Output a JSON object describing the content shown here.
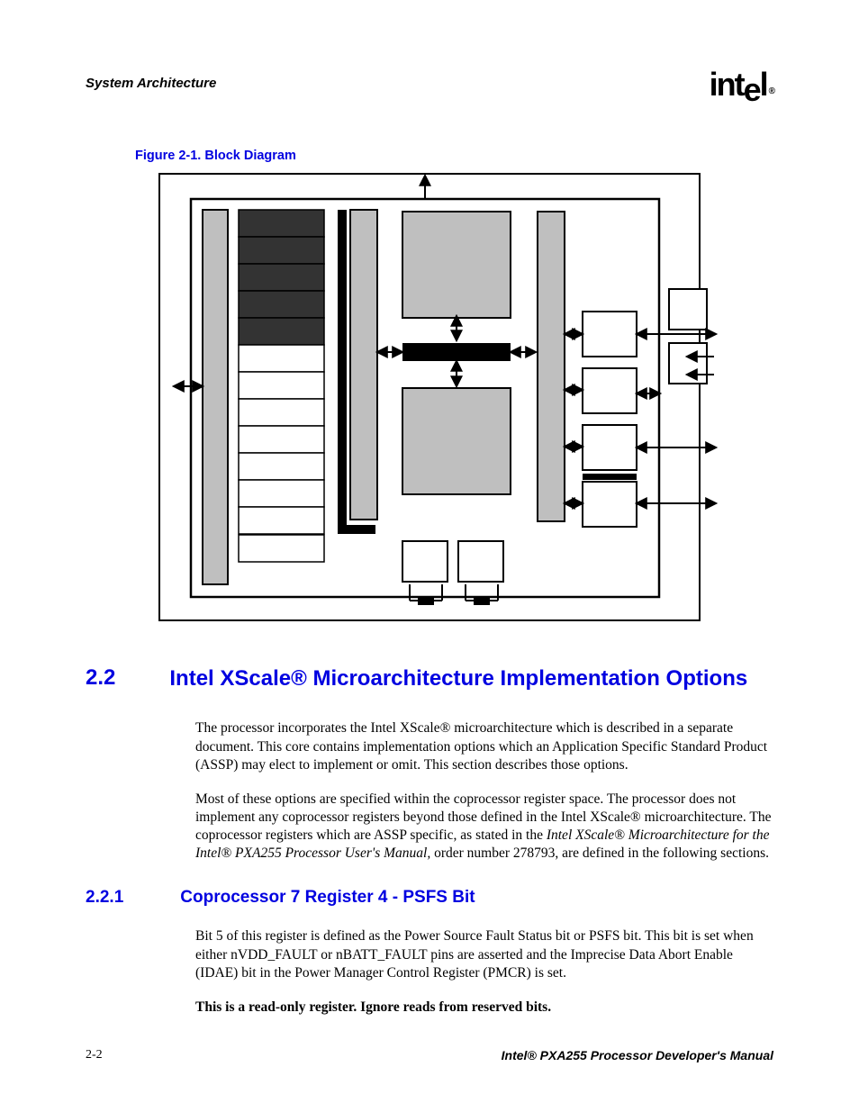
{
  "header": {
    "section": "System Architecture",
    "logo_text": "int",
    "logo_text2": "e",
    "logo_text3": "l",
    "logo_reg": "®"
  },
  "figure": {
    "caption": "Figure 2-1. Block Diagram"
  },
  "section_2_2": {
    "number": "2.2",
    "title": "Intel XScale® Microarchitecture Implementation Options",
    "para1_a": "The processor incorporates the Intel XScale® microarchitecture which is described in a separate document. This core contains implementation options which an Application Specific Standard Product (ASSP) may elect to implement or omit. This section describes those options.",
    "para2_a": "Most of these options are specified within the coprocessor register space. The processor does not implement any coprocessor registers beyond those defined in the Intel XScale® microarchitecture. The coprocessor registers which are ASSP specific, as stated in the ",
    "para2_i": "Intel XScale® Microarchitecture for the Intel® PXA255 Processor User's Manual,",
    "para2_b": " order number 278793, are defined in the following sections."
  },
  "section_2_2_1": {
    "number": "2.2.1",
    "title": "Coprocessor 7 Register 4 - PSFS Bit",
    "para1": "Bit 5 of this register is defined as the Power Source Fault Status bit or PSFS bit. This bit is set when either nVDD_FAULT or nBATT_FAULT pins are asserted and the Imprecise Data Abort Enable (IDAE) bit in the Power Manager Control Register (PMCR) is set.",
    "para2": "This is a read-only register. Ignore reads from reserved bits."
  },
  "footer": {
    "page": "2-2",
    "manual": "Intel® PXA255 Processor Developer's Manual"
  }
}
